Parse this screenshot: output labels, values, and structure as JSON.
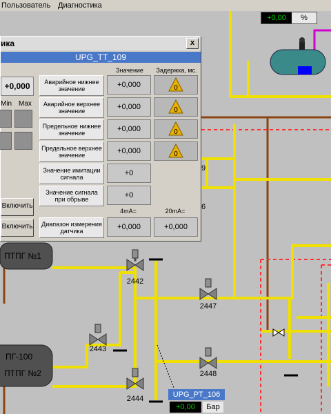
{
  "menu": {
    "items": [
      "Пользователь",
      "Диагностика"
    ]
  },
  "top_indicator": {
    "value": "+0,00",
    "unit": "%"
  },
  "dialog": {
    "title": "ика",
    "close": "x",
    "header": "UPG_TT_109",
    "current_value": "+0,000",
    "min_label": "Min",
    "max_label": "Max",
    "col_value": "Значение",
    "col_delay": "Задержка, мс.",
    "rows": [
      {
        "label": "Аварийное нижнее значение",
        "value": "+0,000",
        "delay": "0"
      },
      {
        "label": "Аварийное верхнее значение",
        "value": "+0,000",
        "delay": "0"
      },
      {
        "label": "Предельное нижнее значение",
        "value": "+0,000",
        "delay": "0"
      },
      {
        "label": "Предельное верхнее значение",
        "value": "+0,000",
        "delay": "0"
      },
      {
        "label": "Значение имитации сигнала",
        "value": "+0"
      },
      {
        "label": "Значение сигнала при обрыве",
        "value": "+0"
      }
    ],
    "range_label": "Диапазон измерения датчика",
    "range_4ma_label": "4mA=",
    "range_20ma_label": "20mA=",
    "range_4ma": "+0,000",
    "range_20ma": "+0,000",
    "btn1": "Включить",
    "btn2": "Включить"
  },
  "scheme": {
    "tank1_label": "ПТПГ №1",
    "tank2_top": "ПГ-100",
    "tank2_label": "ПТПГ №2",
    "valves": [
      "2442",
      "2443",
      "2444",
      "2447",
      "2448"
    ],
    "edge_digit_1": "9",
    "edge_digit_2": "6"
  },
  "pt_widget": {
    "tag": "UPG_PT_106",
    "value": "+0,00",
    "unit": "Бар"
  },
  "colors": {
    "pipe": "#f0e000",
    "brown": "#8b4513",
    "magenta": "#d000d0",
    "header_blue": "#4a78c8",
    "red_dash": "#ff3030"
  }
}
